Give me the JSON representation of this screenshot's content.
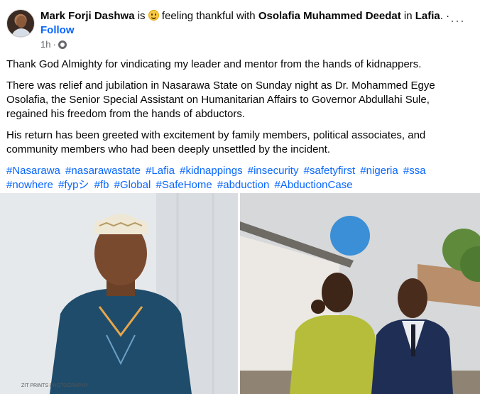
{
  "post": {
    "author": "Mark Forji Dashwa",
    "is_text": "is",
    "feeling": "feeling thankful with",
    "tagged": "Osolafia Muhammed Deedat",
    "in_text": "in",
    "location": "Lafia",
    "separator": ".",
    "dot": "·",
    "follow": "Follow",
    "time": "1h",
    "time_dot": "·",
    "more": "···",
    "paragraphs": [
      "Thank God Almighty for vindicating my leader and mentor from the hands of kidnappers.",
      "There was relief and jubilation in Nasarawa State on Sunday night as Dr. Mohammed Egye Osolafia, the Senior Special Assistant on Humanitarian Affairs to Governor Abdullahi Sule, regained his freedom from the hands of abductors.",
      "His return has been greeted with excitement by family members, political associates, and community members who had been deeply unsettled by the incident."
    ],
    "hashtags": [
      "#Nasarawa",
      "#nasarawastate",
      "#Lafia",
      "#kidnappings",
      "#insecurity",
      "#safetyfirst",
      "#nigeria",
      "#ssa",
      "#nowhere",
      "#fypシ",
      "#fb",
      "#Global",
      "#SafeHome",
      "#abduction",
      "#AbductionCase"
    ],
    "photo_watermark": "ZIT PRINTS PHOTOGRAPHY"
  },
  "colors": {
    "link": "#0866ff",
    "secondary_text": "#65676b",
    "text": "#050505"
  }
}
